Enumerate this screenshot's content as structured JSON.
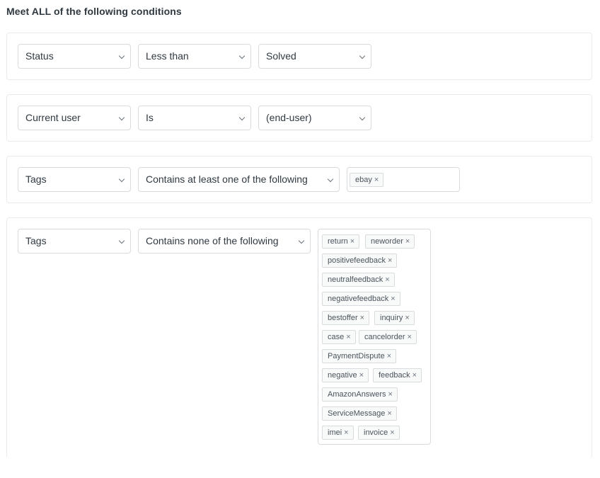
{
  "heading": "Meet ALL of the following conditions",
  "conditions": [
    {
      "field": "Status",
      "operator": "Less than",
      "value": "Solved"
    },
    {
      "field": "Current user",
      "operator": "Is",
      "value": "(end-user)"
    },
    {
      "field": "Tags",
      "operator": "Contains at least one of the following",
      "tags": [
        "ebay"
      ]
    },
    {
      "field": "Tags",
      "operator": "Contains none of the following",
      "tags": [
        "return",
        "neworder",
        "positivefeedback",
        "neutralfeedback",
        "negativefeedback",
        "bestoffer",
        "inquiry",
        "case",
        "cancelorder",
        "PaymentDispute",
        "negative",
        "feedback",
        "AmazonAnswers",
        "ServiceMessage",
        "imei",
        "invoice"
      ]
    }
  ],
  "remove_glyph": "×"
}
